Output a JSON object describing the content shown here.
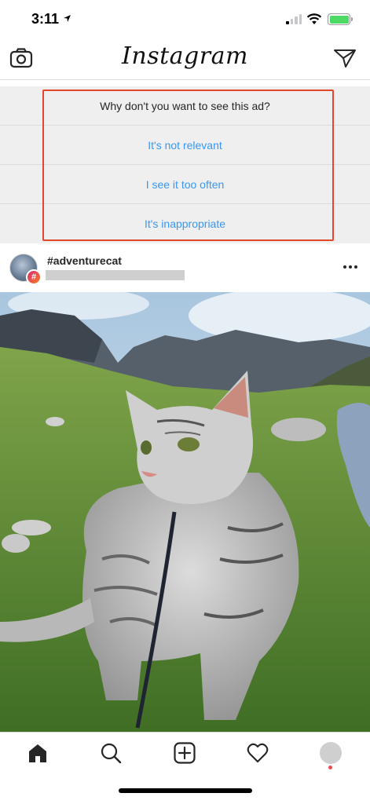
{
  "status_bar": {
    "time": "3:11"
  },
  "header": {
    "logo": "Instagram"
  },
  "ad_feedback": {
    "question": "Why don't you want to see this ad?",
    "options": [
      "It's not relevant",
      "I see it too often",
      "It's inappropriate"
    ]
  },
  "post": {
    "username": "#adventurecat",
    "badge": "#"
  },
  "icons": {
    "status": [
      "location-arrow-icon",
      "signal-icon",
      "wifi-icon",
      "battery-icon"
    ],
    "header": [
      "camera-icon",
      "direct-send-icon"
    ],
    "post": [
      "more-options-icon"
    ],
    "tabs": [
      "home-icon",
      "search-icon",
      "new-post-icon",
      "activity-heart-icon",
      "profile-icon"
    ]
  },
  "colors": {
    "link_blue": "#3897f0",
    "highlight_red": "#e2472c",
    "battery_green": "#4cd964",
    "notification_red": "#ed4956"
  }
}
